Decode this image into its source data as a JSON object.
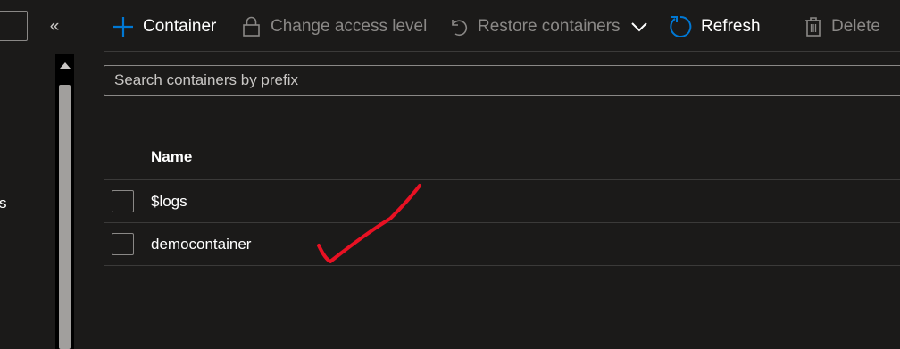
{
  "sidebar": {
    "collapse_glyph": "«",
    "truncated_text": "s"
  },
  "toolbar": {
    "add_container_label": "Container",
    "change_access_label": "Change access level",
    "restore_label": "Restore containers",
    "refresh_label": "Refresh",
    "delete_label": "Delete",
    "icons": [
      "plus-icon",
      "lock-icon",
      "undo-icon",
      "chevron-down-icon",
      "refresh-icon",
      "trash-icon"
    ],
    "accent_color": "#0078d4"
  },
  "search": {
    "placeholder": "Search containers by prefix"
  },
  "table": {
    "columns": [
      "Name"
    ],
    "rows": [
      {
        "name": "$logs"
      },
      {
        "name": "democontainer"
      }
    ]
  },
  "annotation": {
    "shape": "checkmark",
    "color": "#e81123"
  }
}
